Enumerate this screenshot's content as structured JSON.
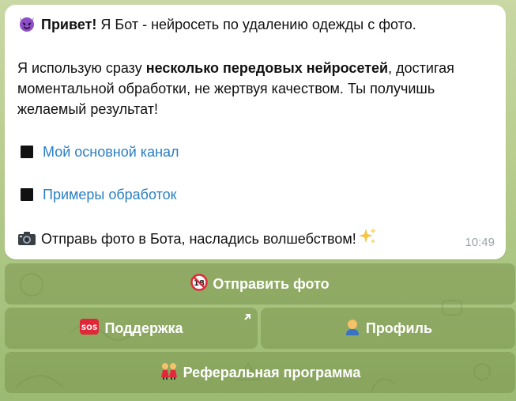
{
  "message": {
    "greeting_bold": "Привет!",
    "greeting_rest": " Я Бот - нейросеть по удалению одежды с фото.",
    "para2_start": "Я использую сразу ",
    "para2_bold": "несколько передовых нейросетей",
    "para2_end": ", достигая",
    "para2_line2": "моментальной обработки, не жертвуя качеством. Ты получишь",
    "para2_line3": "желаемый результат!",
    "link_channel": "Мой основной канал",
    "link_examples": "Примеры обработок",
    "footer": "Отправь фото в Бота, насладись волшебством!",
    "time": "10:49",
    "icons": [
      "smiling-devil-icon",
      "black-square-icon",
      "camera-icon",
      "sparkles-icon"
    ]
  },
  "keyboard": {
    "send_photo": "Отправить фото",
    "support": "Поддержка",
    "profile": "Профиль",
    "referral": "Реферальная программа",
    "icons": [
      "no-18-icon",
      "sos-icon",
      "person-icon",
      "two-people-icon",
      "arrow-up-right-icon"
    ]
  },
  "colors": {
    "link": "#2a7fc4",
    "bubble_bg": "#ffffff",
    "button_bg": "#708c42",
    "time": "#9aa4a8"
  }
}
